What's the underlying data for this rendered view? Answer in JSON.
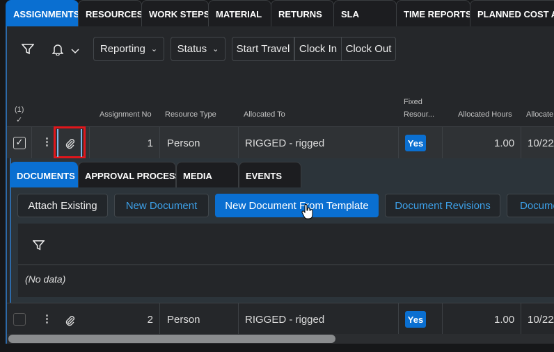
{
  "tabs": [
    "ASSIGNMENTS",
    "RESOURCES",
    "WORK STEPS",
    "MATERIAL",
    "RETURNS",
    "SLA",
    "TIME REPORTS",
    "PLANNED COST AN"
  ],
  "toolbar": {
    "reporting": "Reporting",
    "status": "Status",
    "start_travel": "Start Travel",
    "clock_in": "Clock In",
    "clock_out": "Clock Out"
  },
  "table": {
    "selected_count": "(1)",
    "headers": {
      "assignment_no": "Assignment No",
      "resource_type": "Resource Type",
      "allocated_to": "Allocated To",
      "fixed_1": "Fixed",
      "fixed_2": "Resour...",
      "allocated_hours": "Allocated Hours",
      "allocate": "Allocate"
    },
    "rows": [
      {
        "no": "1",
        "resource_type": "Person",
        "allocated_to": "RIGGED - rigged",
        "fixed": "Yes",
        "hours": "1.00",
        "date": "10/22/",
        "checked": true
      },
      {
        "no": "2",
        "resource_type": "Person",
        "allocated_to": "RIGGED - rigged",
        "fixed": "Yes",
        "hours": "1.00",
        "date": "10/22/",
        "checked": false
      }
    ]
  },
  "detail": {
    "tabs": [
      "DOCUMENTS",
      "APPROVAL PROCESS",
      "MEDIA",
      "EVENTS"
    ],
    "buttons": {
      "attach_existing": "Attach Existing",
      "new_document": "New Document",
      "new_from_template": "New Document From Template",
      "revisions": "Document Revisions",
      "more": "Docume"
    },
    "empty": "(No data)"
  },
  "colors": {
    "accent": "#0a6fd1",
    "highlight": "#e0161b"
  }
}
